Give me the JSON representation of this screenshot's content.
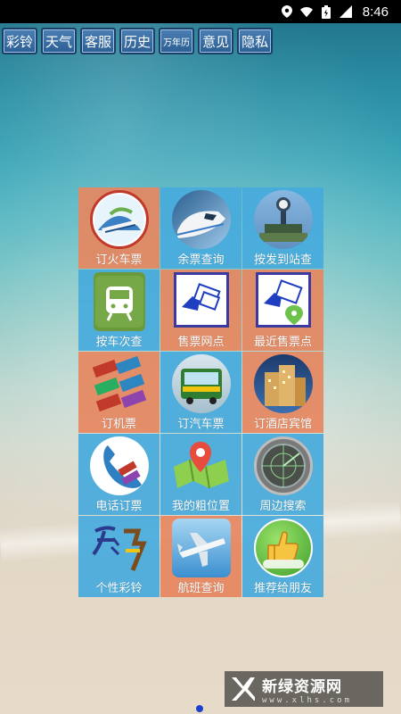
{
  "status_bar": {
    "time": "8:46",
    "icons": [
      "location-icon",
      "wifi-icon",
      "battery-icon",
      "signal-icon"
    ]
  },
  "tabs": [
    {
      "label": "彩铃"
    },
    {
      "label": "天气"
    },
    {
      "label": "客服"
    },
    {
      "label": "历史"
    },
    {
      "label": "万年历"
    },
    {
      "label": "意见"
    },
    {
      "label": "隐私"
    }
  ],
  "grid": [
    {
      "label": "订火车票",
      "icon": "train-ticket-icon"
    },
    {
      "label": "余票查询",
      "icon": "bullet-train-icon"
    },
    {
      "label": "按发到站查",
      "icon": "station-icon"
    },
    {
      "label": "按车次查",
      "icon": "train-number-icon"
    },
    {
      "label": "售票网点",
      "icon": "ticket-office-icon"
    },
    {
      "label": "最近售票点",
      "icon": "nearest-office-icon"
    },
    {
      "label": "订机票",
      "icon": "air-ticket-icon"
    },
    {
      "label": "订汽车票",
      "icon": "bus-icon"
    },
    {
      "label": "订酒店宾馆",
      "icon": "hotel-icon"
    },
    {
      "label": "电话订票",
      "icon": "phone-icon"
    },
    {
      "label": "我的粗位置",
      "icon": "map-pin-icon"
    },
    {
      "label": "周边搜索",
      "icon": "radar-icon"
    },
    {
      "label": "个性彩铃",
      "icon": "ringtone-icon"
    },
    {
      "label": "航班查询",
      "icon": "airplane-icon"
    },
    {
      "label": "推荐给朋友",
      "icon": "thumbs-up-icon"
    }
  ],
  "watermark": {
    "title": "新绿资源网",
    "subtitle": "www.xlhs.com"
  },
  "colors": {
    "tile_orange": "#e6875f",
    "tile_blue": "#46aadc",
    "tab_blue": "#3a6fa5",
    "page_dot": "#1f3fd0"
  }
}
